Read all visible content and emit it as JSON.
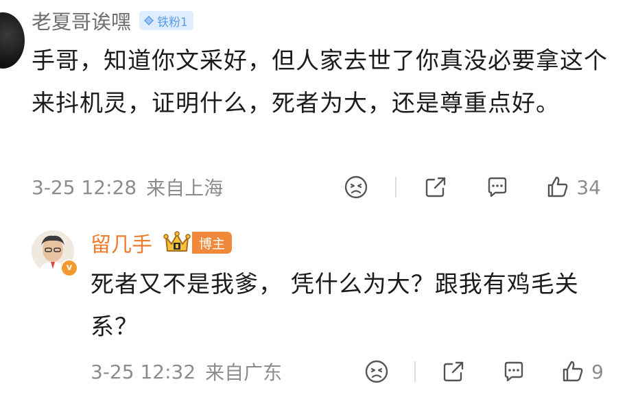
{
  "comments": [
    {
      "username": "老夏哥诶嘿",
      "fan_badge": "铁粉1",
      "text": "手哥，知道你文采好，但人家去世了你真没必要拿这个来抖机灵，证明什么，死者为大，还是尊重点好。",
      "time": "3-25 12:28",
      "location": "来自上海",
      "likes": "34"
    },
    {
      "username": "留几手",
      "host_badge": "博主",
      "verified_badge": "v",
      "text": "死者又不是我爹， 凭什么为大？跟我有鸡毛关系？",
      "time": "3-25 12:32",
      "location": "来自广东",
      "likes": "9"
    }
  ],
  "icons": {
    "dislike": "sad-face-icon",
    "share": "share-icon",
    "reply": "comment-icon",
    "like": "thumbs-up-icon"
  },
  "colors": {
    "username_gray": "#6e6e6e",
    "host_orange": "#ef7b2c",
    "fan_badge_bg": "#dfeeff",
    "fan_badge_text": "#5a9bea",
    "meta_gray": "#8c8c8c"
  }
}
